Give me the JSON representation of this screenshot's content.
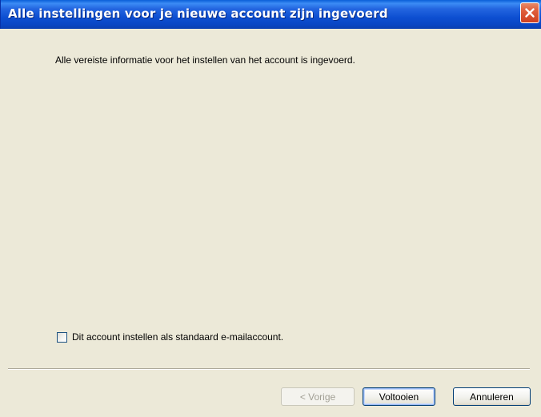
{
  "dialog": {
    "title": "Alle instellingen voor je nieuwe account zijn ingevoerd",
    "close_icon": "close-icon",
    "info_text": "Alle vereiste informatie voor het instellen van het account is ingevoerd.",
    "checkbox": {
      "label": "Dit account instellen als standaard e-mailaccount.",
      "checked": false
    },
    "buttons": {
      "previous_label": "< Vorige",
      "previous_enabled": false,
      "finish_label": "Voltooien",
      "cancel_label": "Annuleren"
    }
  },
  "colors": {
    "titlebar": "#0a46c4",
    "window_background": "#ece9d8",
    "close_button": "#e0613e"
  }
}
